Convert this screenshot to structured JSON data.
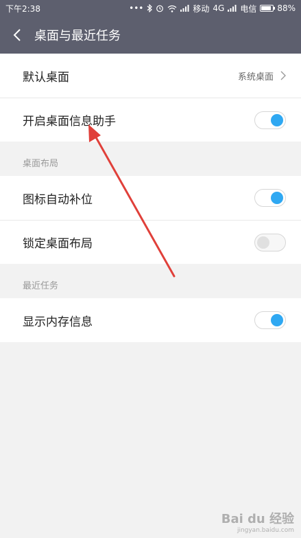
{
  "status_bar": {
    "time": "下午2:38",
    "dots": "•••",
    "carrier1": "移动",
    "network": "4G",
    "carrier2": "电信",
    "battery_percent": "88%",
    "battery_level": 0.88
  },
  "header": {
    "back_icon": "chevron-left-icon",
    "title": "桌面与最近任务"
  },
  "main": {
    "default_desktop": {
      "label": "默认桌面",
      "value": "系统桌面"
    },
    "desktop_assistant": {
      "label": "开启桌面信息助手",
      "enabled": true
    },
    "section_layout": {
      "header": "桌面布局"
    },
    "auto_fill_icons": {
      "label": "图标自动补位",
      "enabled": true
    },
    "lock_layout": {
      "label": "锁定桌面布局",
      "enabled": false
    },
    "section_recent": {
      "header": "最近任务"
    },
    "show_memory": {
      "label": "显示内存信息",
      "enabled": true
    }
  },
  "annotation": {
    "color": "#e0403a"
  },
  "colors": {
    "bar": "#5d5f6e",
    "toggle_on": "#2fa8f2"
  },
  "watermark": {
    "text": "Bai du 经验",
    "sub": "jingyan.baidu.com"
  }
}
